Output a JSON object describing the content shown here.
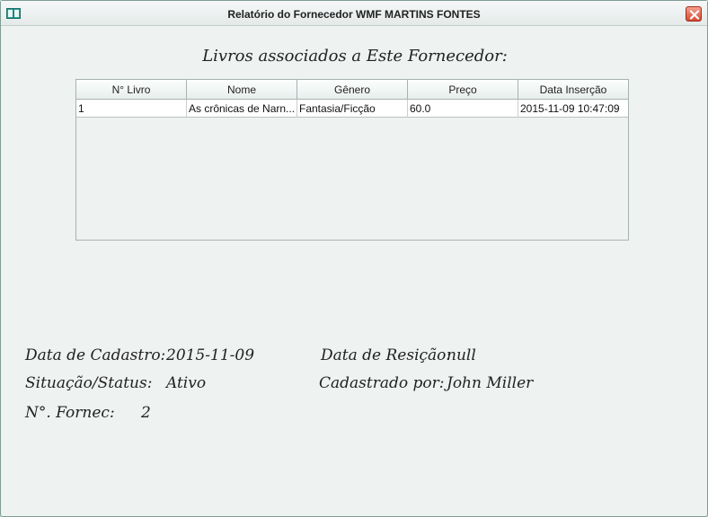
{
  "window": {
    "title": "Relatório do Fornecedor WMF MARTINS FONTES"
  },
  "heading": "Livros associados a Este Fornecedor:",
  "table": {
    "columns": [
      "N° Livro",
      "Nome",
      "Gênero",
      "Preço",
      "Data Inserção"
    ],
    "rows": [
      [
        "1",
        "As crônicas de Narn...",
        "Fantasia/Ficção",
        "60.0",
        "2015-11-09 10:47:09"
      ]
    ]
  },
  "details": {
    "cadastro_label": "Data de Cadastro:",
    "cadastro_value": "2015-11-09",
    "rescisao_label": "Data de Resição:",
    "rescisao_value": "null",
    "status_label": "Situação/Status:",
    "status_value": "Ativo",
    "cadastrado_label": "Cadastrado por:",
    "cadastrado_value": "John Miller",
    "fornec_label": "N°. Fornec:",
    "fornec_value": "2"
  },
  "colors": {
    "window_bg": "#eef2f1",
    "close_red": "#d6492f",
    "icon_teal": "#2aa39a"
  },
  "icons": {
    "app": "book-icon",
    "close": "close-icon"
  }
}
